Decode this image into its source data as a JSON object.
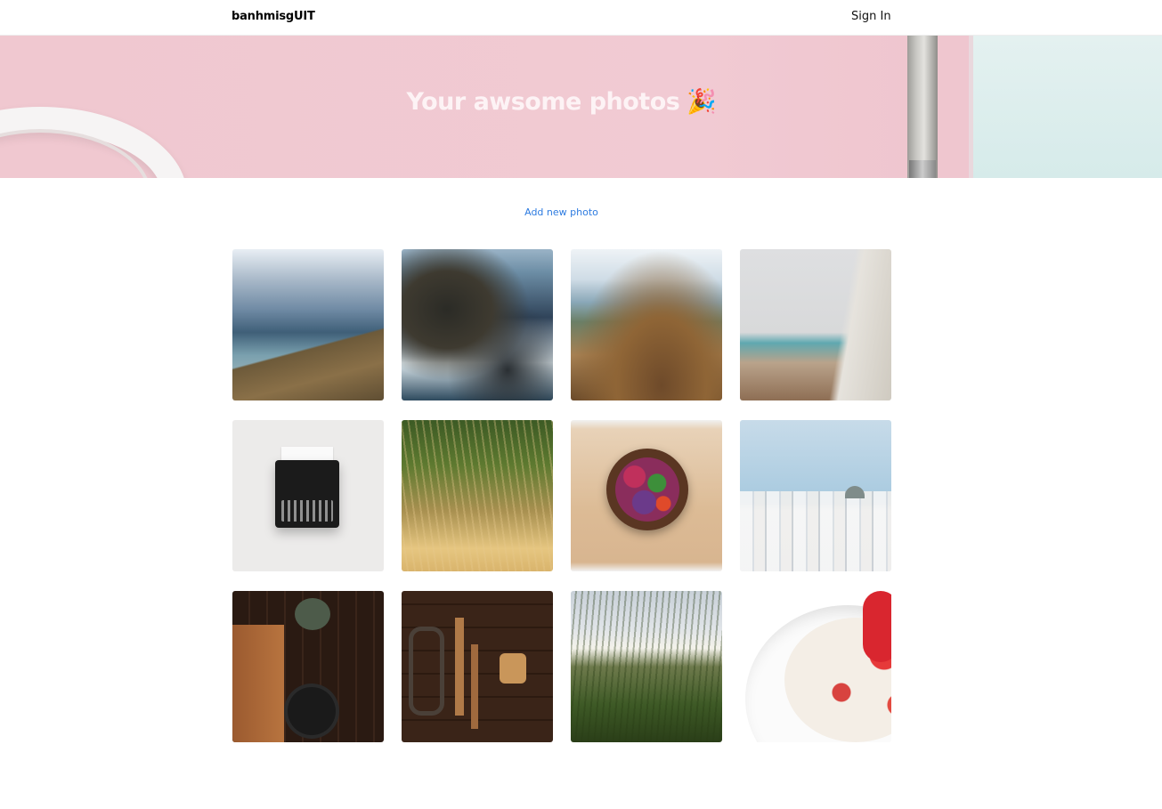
{
  "nav": {
    "brand": "banhmisgUIT",
    "sign_in": "Sign In"
  },
  "hero": {
    "title": "Your awsome photos",
    "emoji": "🎉"
  },
  "actions": {
    "add_photo": "Add new photo"
  },
  "gallery": {
    "photos": [
      {
        "subject": "mountain lake valley"
      },
      {
        "subject": "sea cliffs waves"
      },
      {
        "subject": "mountain ridge"
      },
      {
        "subject": "foggy beach cliffs"
      },
      {
        "subject": "typewriter"
      },
      {
        "subject": "grass field"
      },
      {
        "subject": "salad bowl"
      },
      {
        "subject": "white village windmills"
      },
      {
        "subject": "kitchen tools flatlay"
      },
      {
        "subject": "workshop tools flatlay"
      },
      {
        "subject": "dandelion field"
      },
      {
        "subject": "yogurt with strawberries"
      }
    ]
  },
  "colors": {
    "link": "#2d7be0",
    "hero_pink": "#f0c8d0"
  }
}
